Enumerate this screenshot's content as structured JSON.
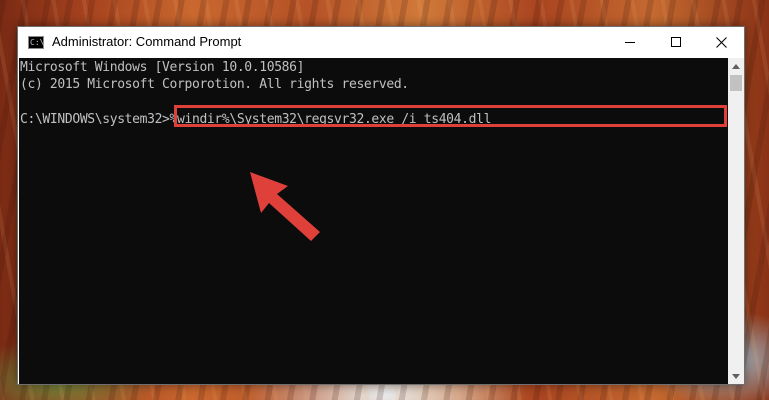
{
  "window": {
    "title": "Administrator: Command Prompt",
    "icon_glyph": "C:\\",
    "controls": {
      "minimize": "minimize-icon",
      "maximize": "maximize-icon",
      "close": "close-icon"
    }
  },
  "console": {
    "lines": [
      "Microsoft Windows [Version 10.0.10586]",
      "(c) 2015 Microsoft Corporotion. All rights reserved."
    ],
    "prompt": "C:\\WINDOWS\\system32>",
    "command": "%windir%\\System32\\regsvr32.exe /i ts404.dll"
  },
  "annotation": {
    "highlight_color": "#e0403a",
    "arrow_color": "#e0403a",
    "arrow_icon": "arrow-pointer-icon"
  },
  "colors": {
    "console_bg": "#0c0c0c",
    "console_text": "#c0c0c0"
  }
}
